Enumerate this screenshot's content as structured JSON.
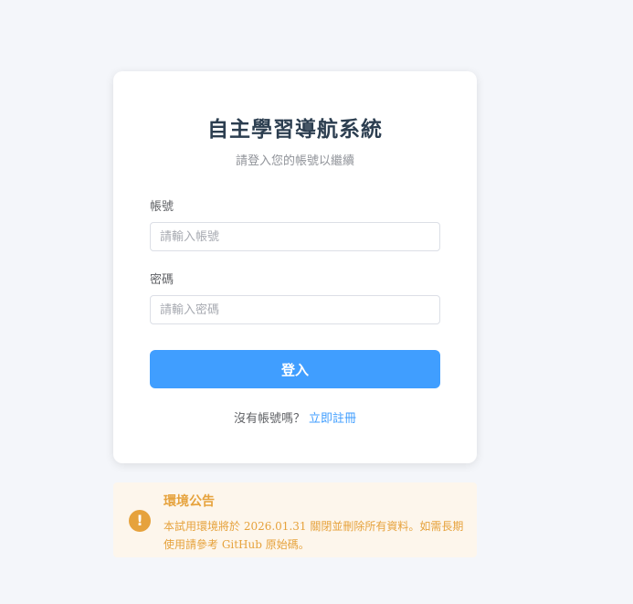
{
  "login": {
    "title": "自主學習導航系統",
    "subtitle": "請登入您的帳號以繼續",
    "username_label": "帳號",
    "username_placeholder": "請輸入帳號",
    "password_label": "密碼",
    "password_placeholder": "請輸入密碼",
    "submit_label": "登入",
    "register_prompt": "沒有帳號嗎？",
    "register_link": "立即註冊"
  },
  "notice": {
    "icon": "exclamation-icon",
    "icon_glyph": "!",
    "title": "環境公告",
    "body": "本試用環境將於 2026.01.31 關閉並刪除所有資料。如需長期使用請參考 GitHub 原始碼。"
  },
  "colors": {
    "primary": "#409eff",
    "warning": "#e6a23c",
    "warning_bg": "#fdf6ec",
    "page_bg": "#f4f6fa"
  }
}
